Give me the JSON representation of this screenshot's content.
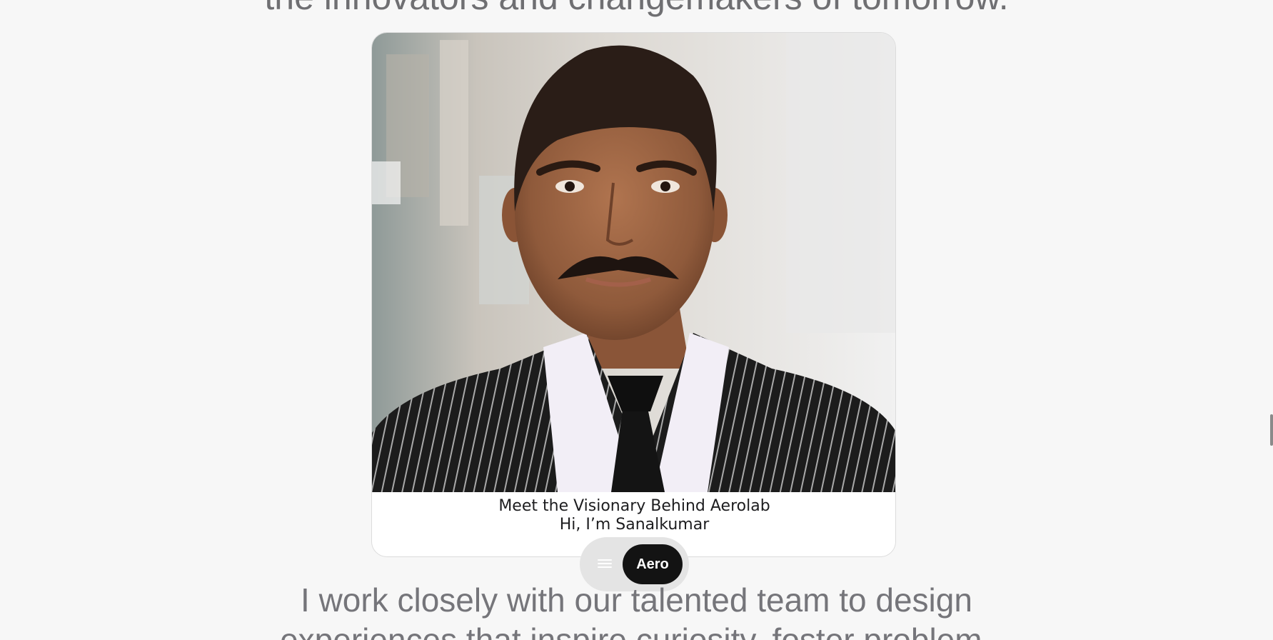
{
  "page": {
    "top_heading": "the innovators and changemakers of tomorrow."
  },
  "card": {
    "portrait_alt": "Portrait photo",
    "caption_line1": "Meet the Visionary Behind Aerolab",
    "caption_line2": "Hi, I’m Sanalkumar"
  },
  "nav_pill": {
    "menu_icon": "hamburger-menu-icon",
    "brand_label": "Aero"
  },
  "intro": {
    "line1": "I work closely with our talented team to design",
    "line2": "experiences that inspire curiosity, foster problem-"
  },
  "colors": {
    "background": "#f7f7f7",
    "heading_text": "#6f6f72",
    "pill_background": "#e4e4e4",
    "brand_button": "#131313"
  }
}
